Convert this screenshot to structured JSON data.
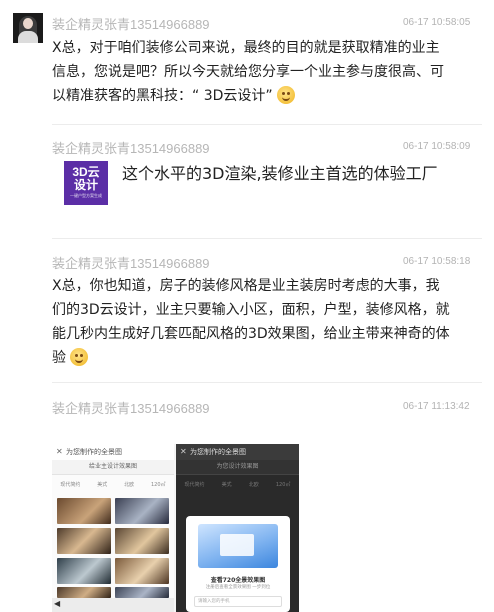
{
  "messages": [
    {
      "sender": "装企精灵张青13514966889",
      "time": "06-17 10:58:05",
      "lines": [
        "X总，对于咱们装修公司来说，最终的目的就是获取精准的业主",
        "信息，您说是吧？所以今天就给您分享一个业主参与度很高、可",
        "以精准获客的黑科技：“ 3D云设计”"
      ]
    },
    {
      "sender": "装企精灵张青13514966889",
      "time": "06-17 10:58:09",
      "logo_line1": "3D云",
      "logo_line2": "设计",
      "logo_line3": "一键户型方案生成",
      "text": "这个水平的3D渲染,装修业主首选的体验工厂"
    },
    {
      "sender": "装企精灵张青13514966889",
      "time": "06-17 10:58:18",
      "lines": [
        "X总，你也知道，房子的装修风格是业主装房时考虑的大事，我",
        "们的3D云设计，业主只要输入小区，面积，户型，装修风格，就",
        "能几秒内生成好几套匹配风格的3D效果图，给业主带来神奇的体",
        "验"
      ]
    },
    {
      "sender": "装企精灵张青13514966889",
      "time": "06-17 11:13:42"
    }
  ],
  "screenshot": {
    "left_title": "为您制作的全景图",
    "left_sub": "给业主设计效果图",
    "left_tabs": [
      "现代简约",
      "美式",
      "北欧",
      "120㎡"
    ],
    "right_title": "为您制作的全景图",
    "right_sub": "为您设计效果图",
    "modal_title": "查看720全景效果图",
    "modal_sub": "注册后查看全景效果图 一步到位",
    "modal_input": "请输入您的手机"
  },
  "colors": {
    "background": "#ffffff",
    "sender": "#b6b6b6",
    "text": "#222222",
    "logo_bg": "#5b2ea6"
  }
}
